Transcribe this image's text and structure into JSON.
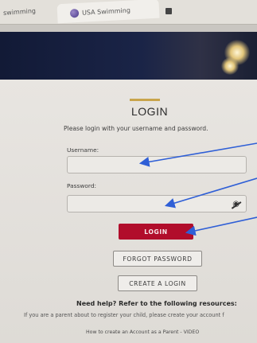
{
  "browser": {
    "tabs": [
      {
        "label": "swimming"
      },
      {
        "label": "USA Swimming"
      },
      {
        "label": ""
      }
    ]
  },
  "login": {
    "title": "LOGIN",
    "intro": "Please login with your username and password.",
    "username_label": "Username:",
    "password_label": "Password:",
    "login_button": "LOGIN",
    "forgot_button": "FORGOT PASSWORD",
    "create_button": "CREATE A LOGIN"
  },
  "help": {
    "title": "Need help? Refer to the following resources:",
    "line": "If you are a parent about to register your child, please create your account f",
    "link": "How to create an Account as a Parent - VIDEO"
  },
  "colors": {
    "brand_red": "#b10d2b",
    "arrow_blue": "#2f5fd6",
    "accent_gold": "#c9a44b"
  }
}
